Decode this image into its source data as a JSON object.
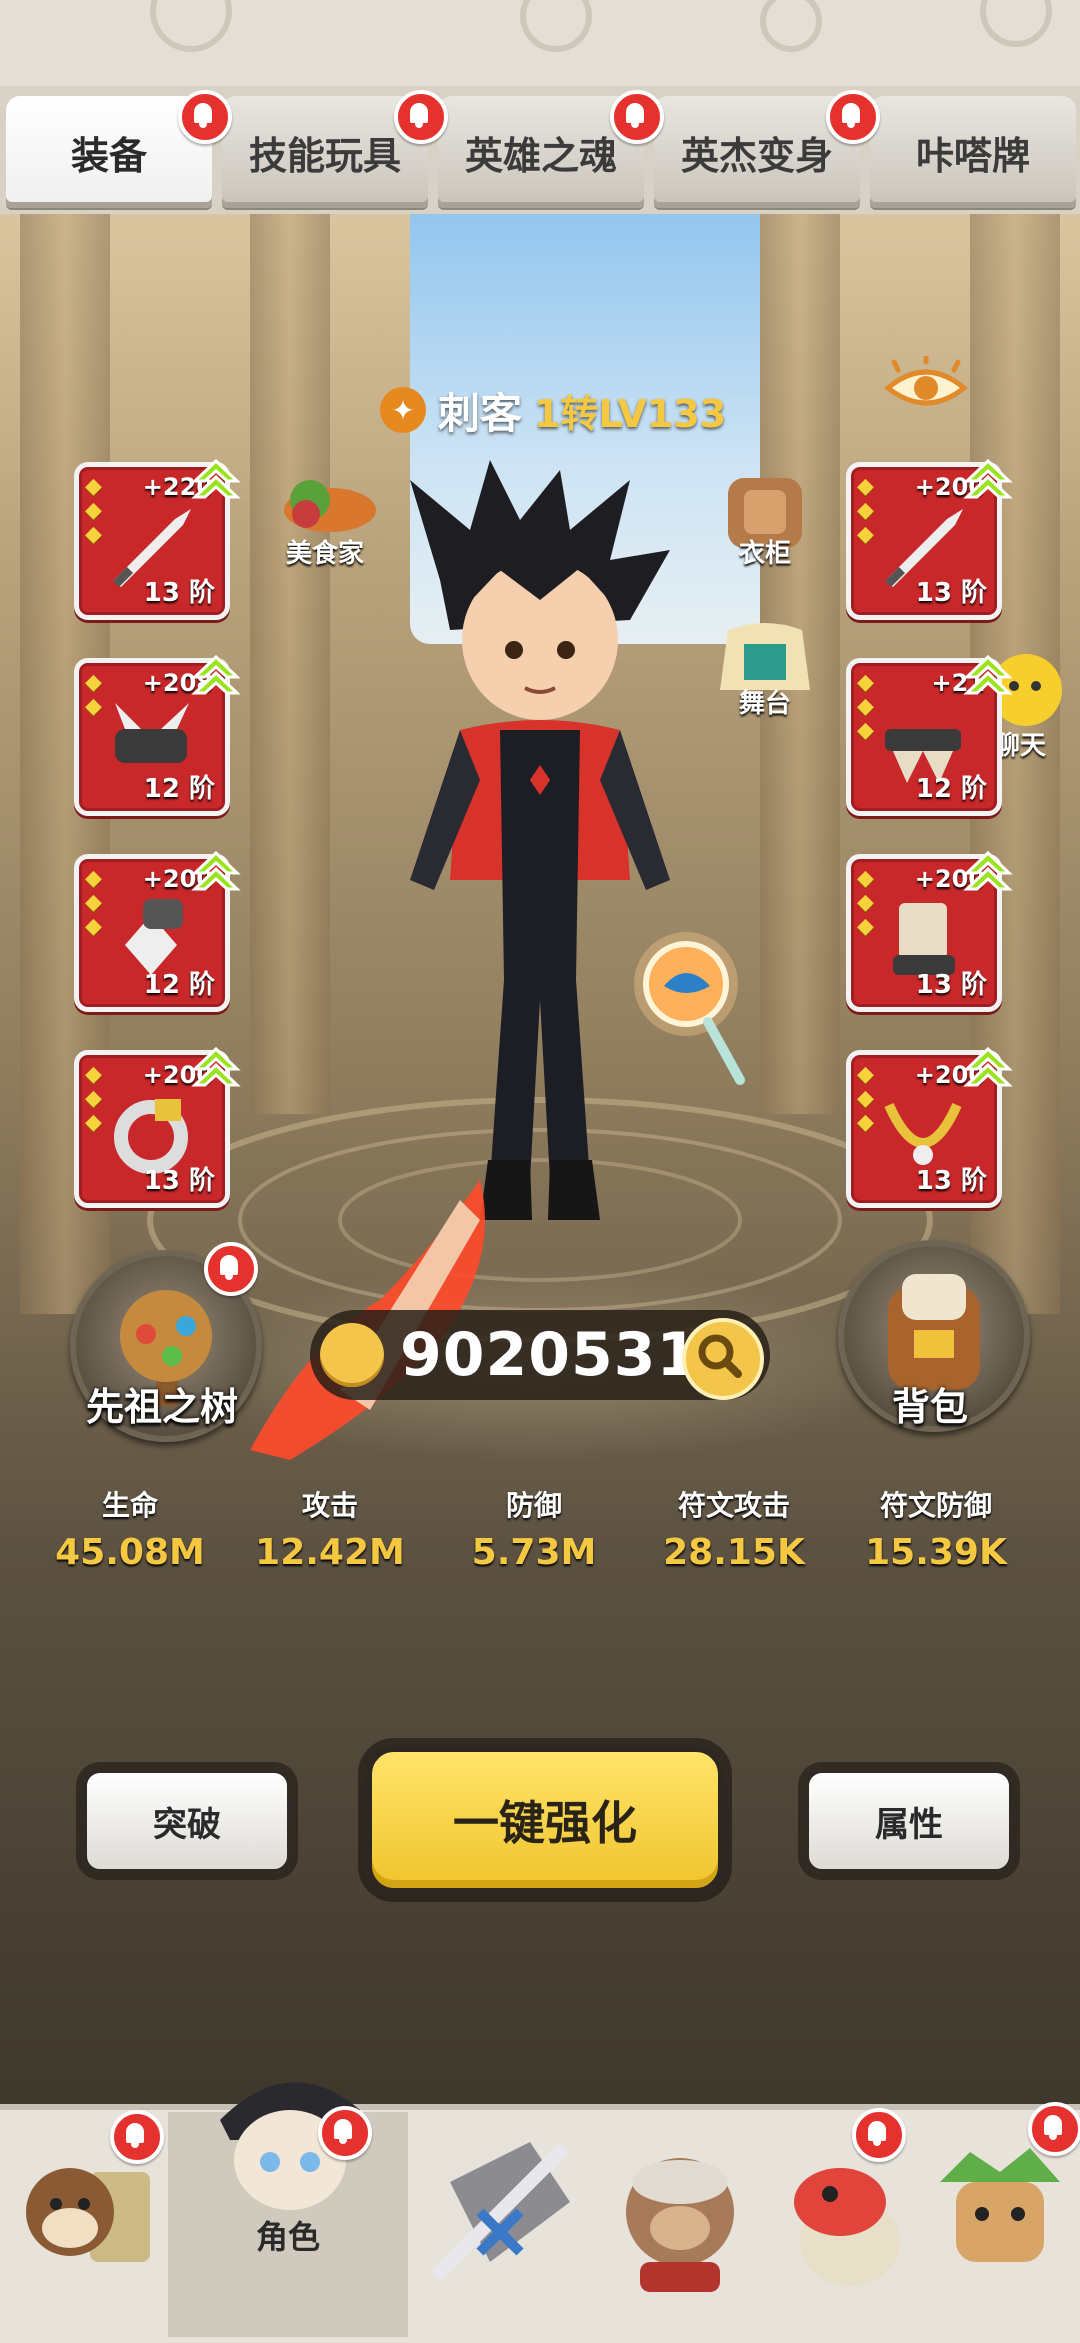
{
  "tabs": [
    {
      "label": "装备",
      "active": true,
      "badge": true
    },
    {
      "label": "技能玩具",
      "active": false,
      "badge": true
    },
    {
      "label": "英雄之魂",
      "active": false,
      "badge": true
    },
    {
      "label": "英杰变身",
      "active": false,
      "badge": true
    },
    {
      "label": "咔嗒牌",
      "active": false,
      "badge": false
    }
  ],
  "hero": {
    "class_name": "刺客",
    "level": "1转LV133",
    "class_icon": "assassin-icon"
  },
  "side_buttons": {
    "food": "美食家",
    "wardrobe": "衣柜",
    "stage": "舞台",
    "chat": "聊天"
  },
  "equipment": {
    "left": [
      {
        "plus": "+220",
        "tier": "13 阶",
        "icon": "weapon-icon",
        "upgradable": true
      },
      {
        "plus": "+208",
        "tier": "12 阶",
        "icon": "shoulder-armor-icon",
        "upgradable": true
      },
      {
        "plus": "+200",
        "tier": "12 阶",
        "icon": "gauntlet-icon",
        "upgradable": true
      },
      {
        "plus": "+200",
        "tier": "13 阶",
        "icon": "ring-icon",
        "upgradable": true
      }
    ],
    "right": [
      {
        "plus": "+200",
        "tier": "13 阶",
        "icon": "offhand-weapon-icon",
        "upgradable": true
      },
      {
        "plus": "+21",
        "tier": "12 阶",
        "icon": "belt-icon",
        "upgradable": true
      },
      {
        "plus": "+200",
        "tier": "13 阶",
        "icon": "boots-icon",
        "upgradable": true
      },
      {
        "plus": "+200",
        "tier": "13 阶",
        "icon": "necklace-icon",
        "upgradable": true
      }
    ]
  },
  "currency": {
    "value": "90205313",
    "icon": "coin-icon"
  },
  "ancestor_tree": {
    "label": "先祖之树",
    "badge": true
  },
  "backpack": {
    "label": "背包"
  },
  "stats": [
    {
      "label": "生命",
      "value": "45.08M"
    },
    {
      "label": "攻击",
      "value": "12.42M"
    },
    {
      "label": "防御",
      "value": "5.73M"
    },
    {
      "label": "符文攻击",
      "value": "28.15K"
    },
    {
      "label": "符文防御",
      "value": "15.39K"
    }
  ],
  "actions": {
    "breakthrough": "突破",
    "one_click_enhance": "一键强化",
    "attributes": "属性"
  },
  "bottom_nav": [
    {
      "label": "",
      "icon": "home-raccoon-icon",
      "badge": true,
      "active": false
    },
    {
      "label": "角色",
      "icon": "character-icon",
      "badge": true,
      "active": true
    },
    {
      "label": "",
      "icon": "weapon-crest-icon",
      "badge": false,
      "active": false
    },
    {
      "label": "",
      "icon": "monkey-king-icon",
      "badge": false,
      "active": false
    },
    {
      "label": "",
      "icon": "dinosaur-pet-icon",
      "badge": true,
      "active": false
    },
    {
      "label": "",
      "icon": "tribe-boss-icon",
      "badge": true,
      "active": false
    }
  ]
}
